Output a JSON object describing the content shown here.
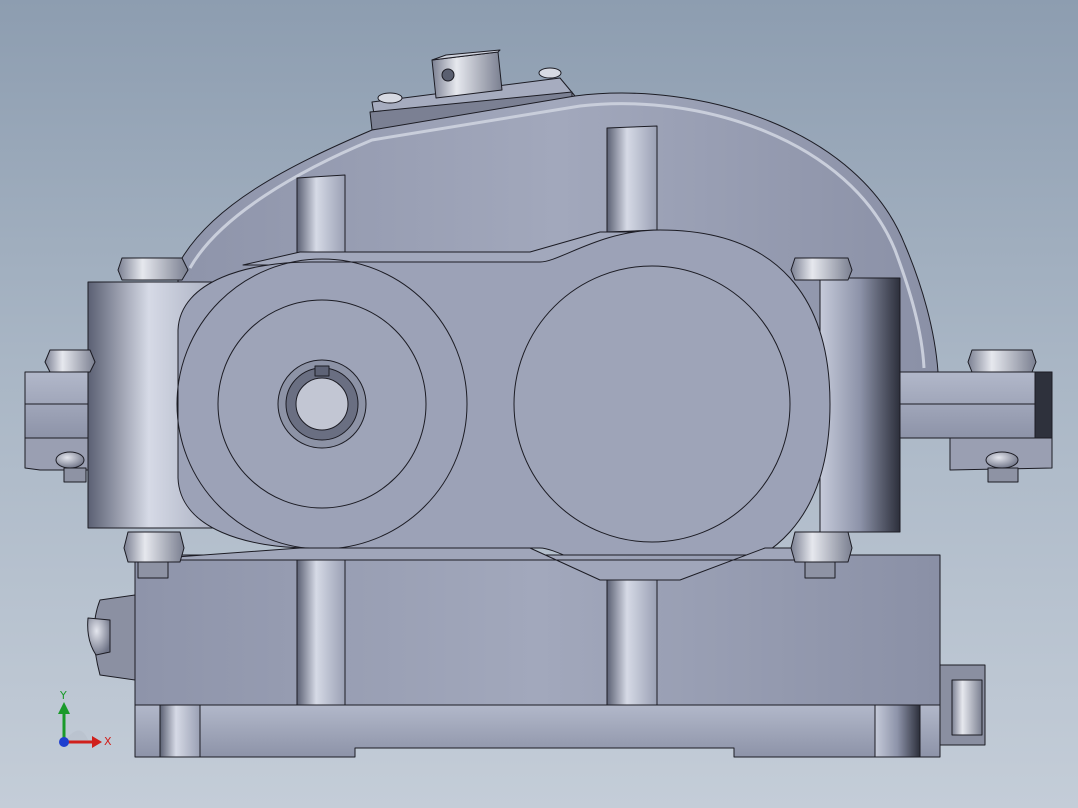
{
  "viewport": {
    "model": "gearbox-housing",
    "background_top": "#8d9db0",
    "background_bottom": "#c4cdd8",
    "part_color": "#9ba1b5",
    "edge_color": "#1c1c24"
  },
  "triad": {
    "x_label": "X",
    "y_label": "Y",
    "x_color": "#d0201c",
    "y_color": "#1a9a2a",
    "z_color": "#1f3fcf"
  }
}
